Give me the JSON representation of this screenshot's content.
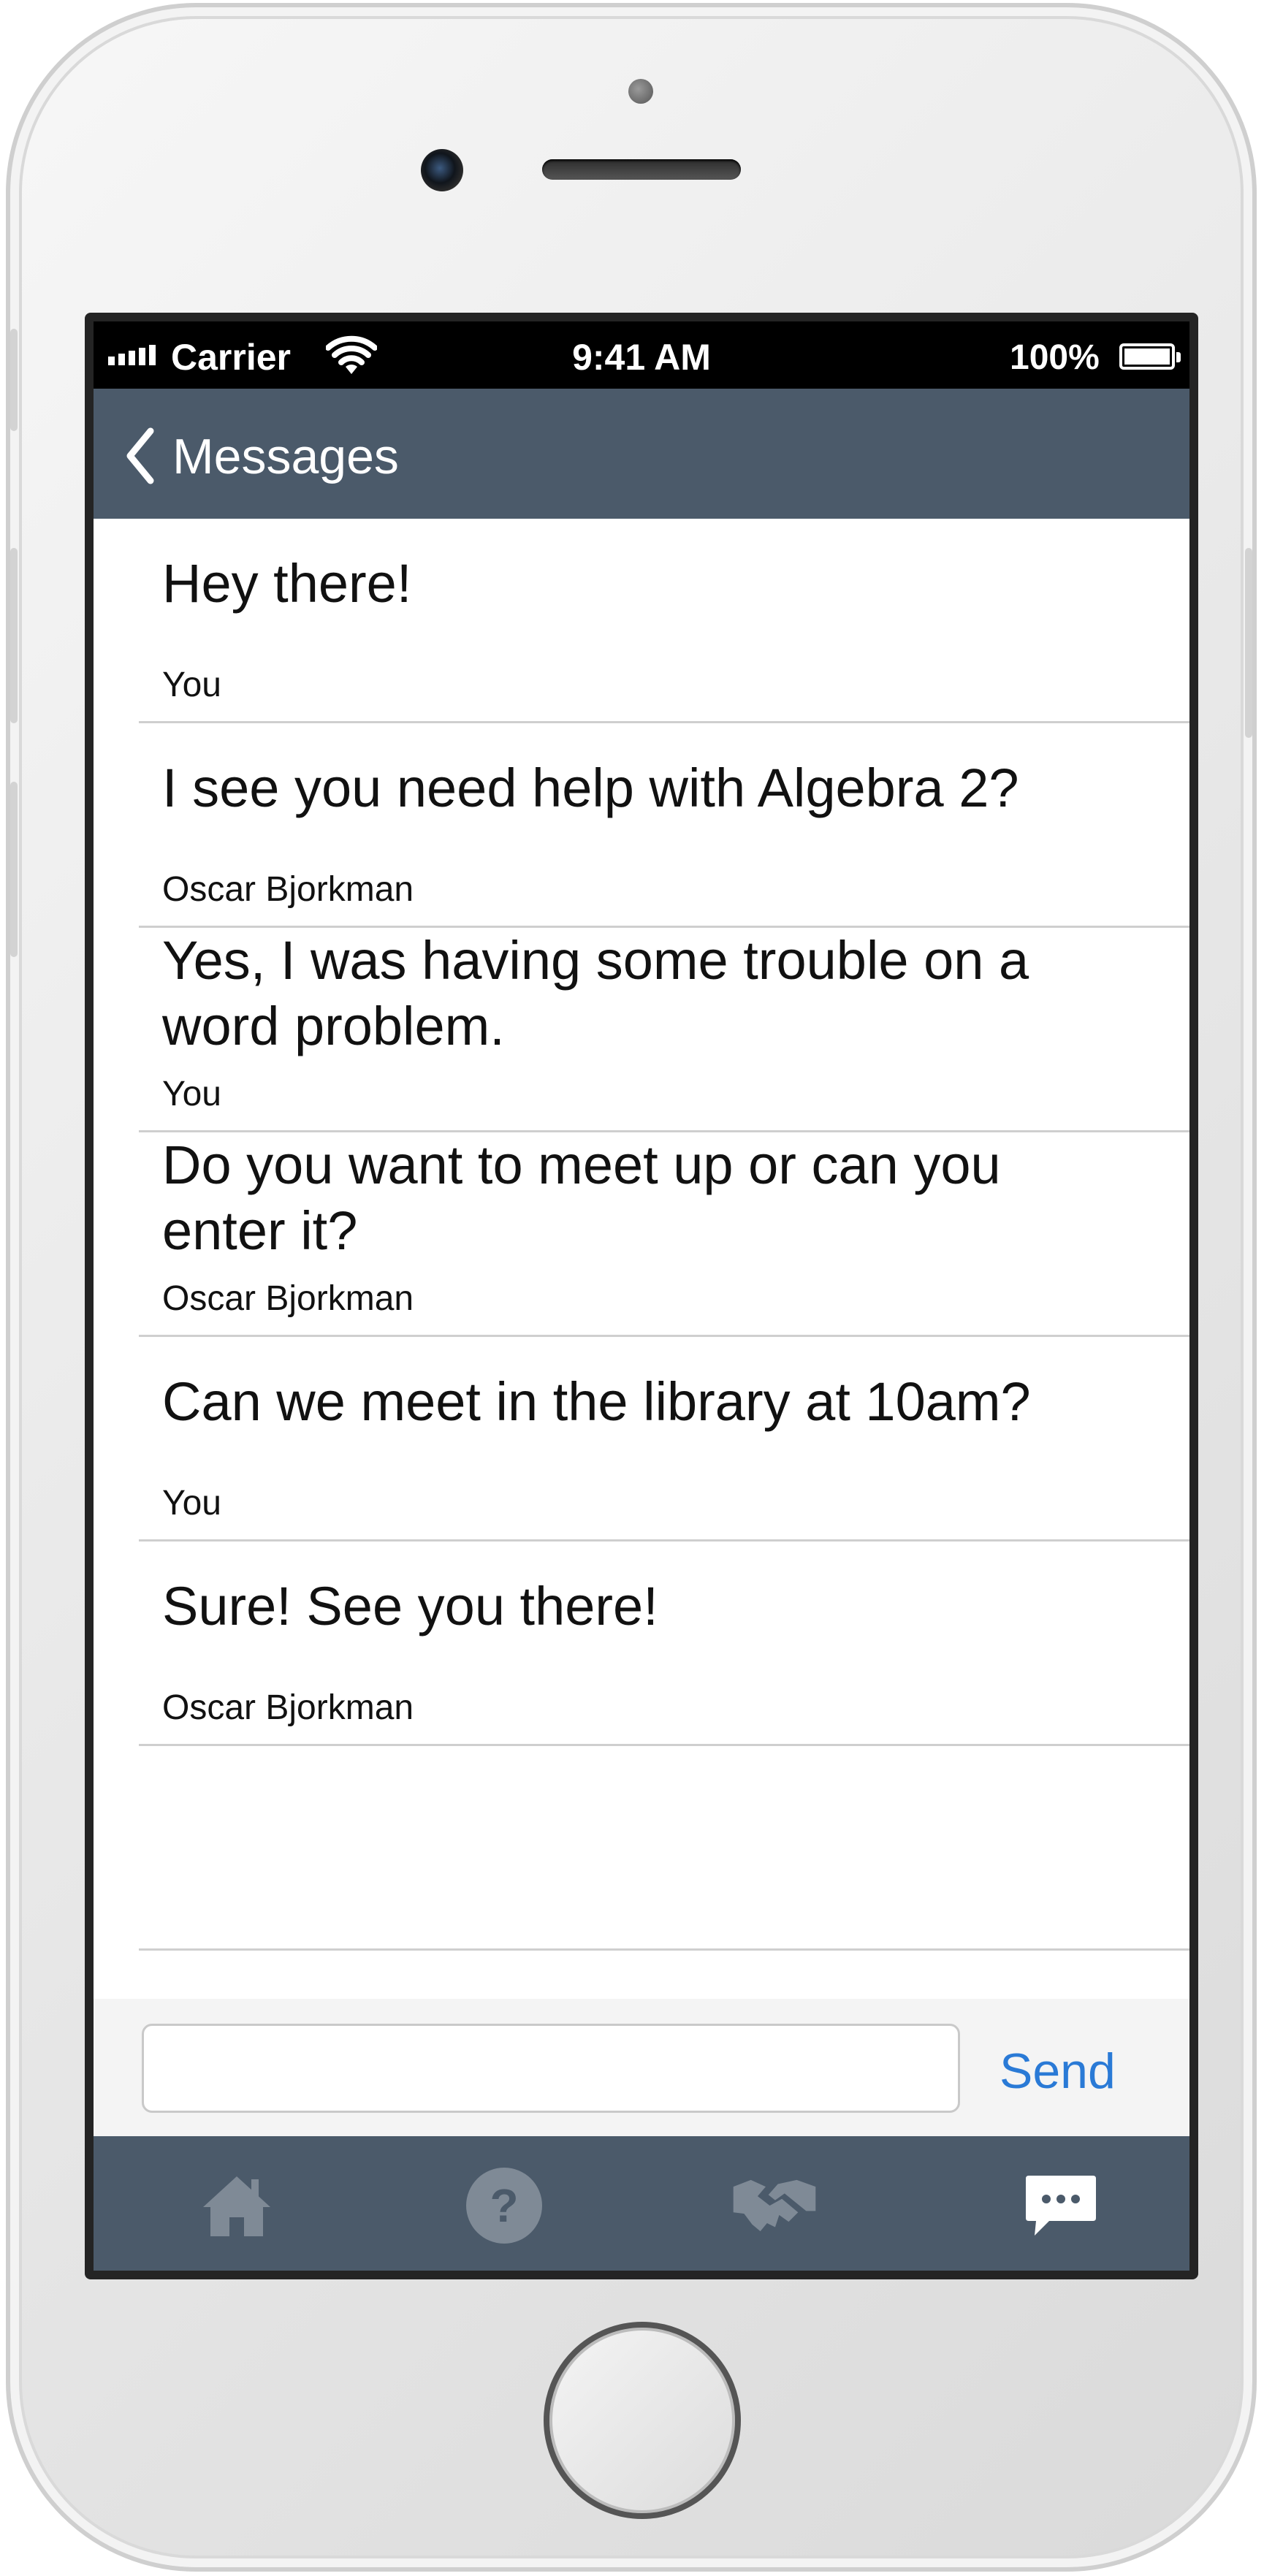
{
  "status_bar": {
    "carrier": "Carrier",
    "time": "9:41 AM",
    "battery": "100%"
  },
  "nav": {
    "back_label": "Messages"
  },
  "messages": [
    {
      "text": "Hey there!",
      "sender": "You"
    },
    {
      "text": "I see you need help with Algebra 2?",
      "sender": "Oscar Bjorkman"
    },
    {
      "text": "Yes, I was having some trouble on a word problem.",
      "sender": "You"
    },
    {
      "text": "Do you want to meet up or can you enter it?",
      "sender": "Oscar Bjorkman"
    },
    {
      "text": "Can we meet in the library at 10am?",
      "sender": "You"
    },
    {
      "text": "Sure! See you there!",
      "sender": "Oscar Bjorkman"
    }
  ],
  "composer": {
    "input_value": "",
    "send_label": "Send"
  },
  "tab_bar": {
    "items": [
      {
        "icon": "home-icon",
        "active": false
      },
      {
        "icon": "help-icon",
        "active": false
      },
      {
        "icon": "handshake-icon",
        "active": false
      },
      {
        "icon": "chat-icon",
        "active": true
      }
    ]
  },
  "colors": {
    "nav_bg": "#4b5a6a",
    "accent": "#2a7ad6",
    "tab_inactive": "#7f8a96",
    "tab_active": "#ffffff"
  }
}
